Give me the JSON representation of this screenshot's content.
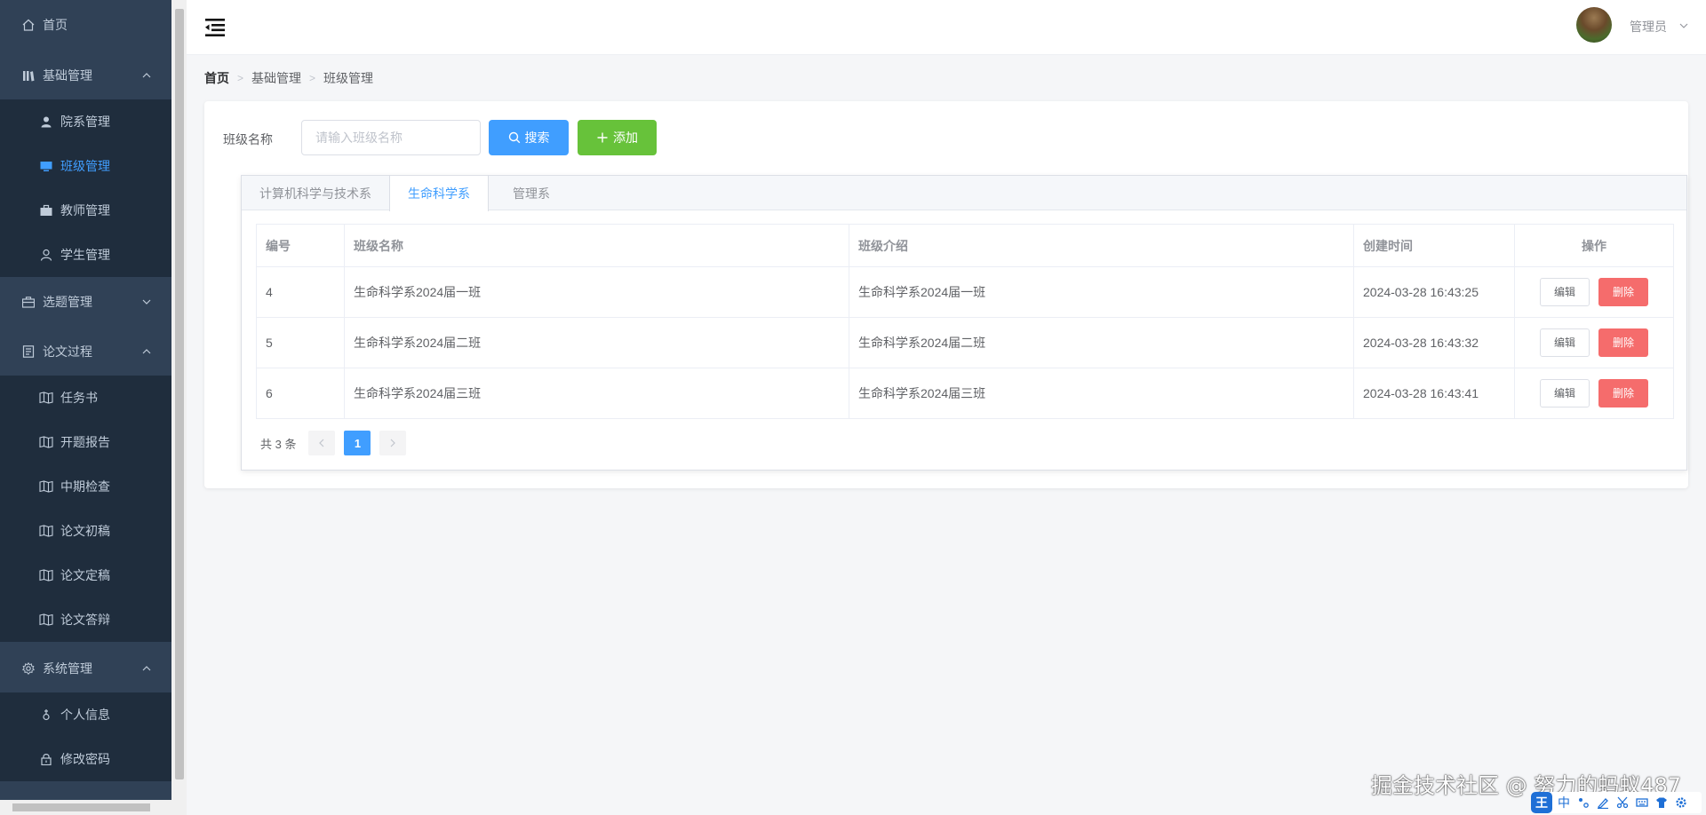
{
  "sidebar": {
    "items": [
      {
        "label": "首页",
        "icon": "home-icon",
        "type": "top"
      },
      {
        "label": "基础管理",
        "icon": "library-icon",
        "type": "group",
        "expanded": true
      },
      {
        "label": "院系管理",
        "icon": "user-solid-icon",
        "type": "sub"
      },
      {
        "label": "班级管理",
        "icon": "monitor-icon",
        "type": "sub",
        "active": true
      },
      {
        "label": "教师管理",
        "icon": "briefcase-icon",
        "type": "sub"
      },
      {
        "label": "学生管理",
        "icon": "user-outline-icon",
        "type": "sub"
      },
      {
        "label": "选题管理",
        "icon": "suitcase-icon",
        "type": "group",
        "expanded": false
      },
      {
        "label": "论文过程",
        "icon": "document-icon",
        "type": "group",
        "expanded": true
      },
      {
        "label": "任务书",
        "icon": "book-icon",
        "type": "sub"
      },
      {
        "label": "开题报告",
        "icon": "book-icon",
        "type": "sub"
      },
      {
        "label": "中期检查",
        "icon": "book-icon",
        "type": "sub"
      },
      {
        "label": "论文初稿",
        "icon": "book-icon",
        "type": "sub"
      },
      {
        "label": "论文定稿",
        "icon": "book-icon",
        "type": "sub"
      },
      {
        "label": "论文答辩",
        "icon": "book-icon",
        "type": "sub"
      },
      {
        "label": "系统管理",
        "icon": "gear-icon",
        "type": "group",
        "expanded": true
      },
      {
        "label": "个人信息",
        "icon": "female-icon",
        "type": "sub"
      },
      {
        "label": "修改密码",
        "icon": "lock-icon",
        "type": "sub"
      }
    ]
  },
  "header": {
    "user_name": "管理员"
  },
  "breadcrumb": [
    "首页",
    "基础管理",
    "班级管理"
  ],
  "search": {
    "label": "班级名称",
    "placeholder": "请输入班级名称",
    "value": "",
    "search_label": "搜索",
    "add_label": "添加"
  },
  "tabs": [
    {
      "label": "计算机科学与技术系",
      "active": false
    },
    {
      "label": "生命科学系",
      "active": true
    },
    {
      "label": "管理系",
      "active": false
    }
  ],
  "table": {
    "columns": [
      "编号",
      "班级名称",
      "班级介绍",
      "创建时间",
      "操作"
    ],
    "rows": [
      {
        "id": "4",
        "name": "生命科学系2024届一班",
        "intro": "生命科学系2024届一班",
        "created": "2024-03-28 16:43:25"
      },
      {
        "id": "5",
        "name": "生命科学系2024届二班",
        "intro": "生命科学系2024届二班",
        "created": "2024-03-28 16:43:32"
      },
      {
        "id": "6",
        "name": "生命科学系2024届三班",
        "intro": "生命科学系2024届三班",
        "created": "2024-03-28 16:43:41"
      }
    ],
    "edit_label": "编辑",
    "delete_label": "删除"
  },
  "pagination": {
    "total_text": "共 3 条",
    "current_page": "1"
  },
  "watermark": "掘金技术社区 @ 努力的蚂蚁487",
  "ime": {
    "logo": "王",
    "mode": "中"
  },
  "colors": {
    "sidebar_bg": "#304156",
    "submenu_bg": "#1f2d3d",
    "primary": "#409eff",
    "success": "#67c23a",
    "danger": "#f56c6c"
  }
}
